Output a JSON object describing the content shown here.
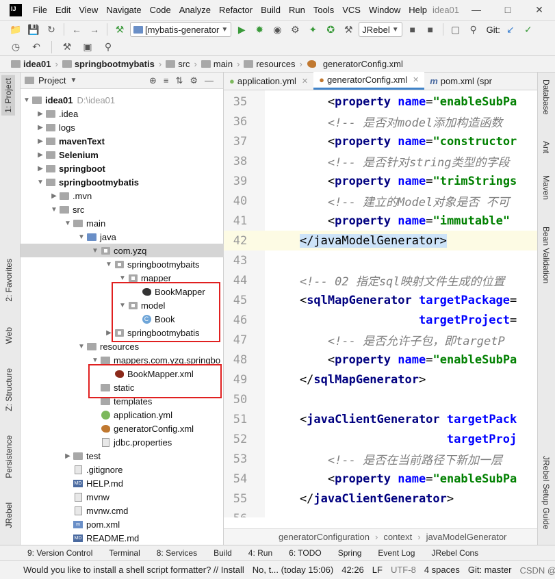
{
  "menubar": {
    "items": [
      "File",
      "Edit",
      "View",
      "Navigate",
      "Code",
      "Analyze",
      "Refactor",
      "Build",
      "Run",
      "Tools",
      "VCS",
      "Window",
      "Help"
    ],
    "window_title": "idea01"
  },
  "toolbar": {
    "run_config": "[mybatis-generator",
    "jrebel": "JRebel",
    "git_label": "Git:"
  },
  "breadcrumb": [
    "idea01",
    "springbootmybatis",
    "src",
    "main",
    "resources",
    "generatorConfig.xml"
  ],
  "project_panel": {
    "title": "Project",
    "tree": [
      {
        "label": "idea01",
        "extra": "D:\\idea01",
        "bold": true
      },
      {
        "label": ".idea"
      },
      {
        "label": "logs"
      },
      {
        "label": "mavenText",
        "bold": true
      },
      {
        "label": "Selenium",
        "bold": true
      },
      {
        "label": "springboot",
        "bold": true
      },
      {
        "label": "springbootmybatis",
        "bold": true
      },
      {
        "label": ".mvn"
      },
      {
        "label": "src"
      },
      {
        "label": "main"
      },
      {
        "label": "java"
      },
      {
        "label": "com.yzq"
      },
      {
        "label": "springbootmybaits"
      },
      {
        "label": "mapper"
      },
      {
        "label": "BookMapper"
      },
      {
        "label": "model"
      },
      {
        "label": "Book"
      },
      {
        "label": "springbootmybatis"
      },
      {
        "label": "resources"
      },
      {
        "label": "mappers.com.yzq.springbo"
      },
      {
        "label": "BookMapper.xml"
      },
      {
        "label": "static"
      },
      {
        "label": "templates"
      },
      {
        "label": "application.yml"
      },
      {
        "label": "generatorConfig.xml"
      },
      {
        "label": "jdbc.properties"
      },
      {
        "label": "test"
      },
      {
        "label": ".gitignore"
      },
      {
        "label": "HELP.md"
      },
      {
        "label": "mvnw"
      },
      {
        "label": "mvnw.cmd"
      },
      {
        "label": "pom.xml"
      },
      {
        "label": "README.md"
      }
    ]
  },
  "left_tabs": [
    "1: Project",
    "2: Favorites",
    "Web",
    "Z: Structure",
    "Persistence",
    "JRebel"
  ],
  "right_tabs": [
    "Database",
    "Ant",
    "Maven",
    "Bean Validation",
    "JRebel Setup Guide"
  ],
  "editor_tabs": [
    "application.yml",
    "generatorConfig.xml",
    "pom.xml (spr"
  ],
  "code_lines": [
    {
      "n": "35",
      "parts": [
        [
          "t",
          "        <"
        ],
        [
          "tag",
          "property"
        ],
        [
          "t",
          " "
        ],
        [
          "attr",
          "name"
        ],
        [
          "t",
          "="
        ],
        [
          "val",
          "\"enableSubPa"
        ]
      ]
    },
    {
      "n": "36",
      "parts": [
        [
          "cmt",
          "        <!-- 是否对model添加构造函数"
        ]
      ]
    },
    {
      "n": "37",
      "parts": [
        [
          "t",
          "        <"
        ],
        [
          "tag",
          "property"
        ],
        [
          "t",
          " "
        ],
        [
          "attr",
          "name"
        ],
        [
          "t",
          "="
        ],
        [
          "val",
          "\"constructor"
        ]
      ]
    },
    {
      "n": "38",
      "parts": [
        [
          "cmt",
          "        <!-- 是否针对string类型的字段"
        ]
      ]
    },
    {
      "n": "39",
      "parts": [
        [
          "t",
          "        <"
        ],
        [
          "tag",
          "property"
        ],
        [
          "t",
          " "
        ],
        [
          "attr",
          "name"
        ],
        [
          "t",
          "="
        ],
        [
          "val",
          "\"trimStrings"
        ]
      ]
    },
    {
      "n": "40",
      "parts": [
        [
          "cmt",
          "        <!-- 建立的Model对象是否 不可"
        ]
      ]
    },
    {
      "n": "41",
      "parts": [
        [
          "t",
          "        <"
        ],
        [
          "tag",
          "property"
        ],
        [
          "t",
          " "
        ],
        [
          "attr",
          "name"
        ],
        [
          "t",
          "="
        ],
        [
          "val",
          "\"immutable\""
        ]
      ]
    },
    {
      "n": "42",
      "parts": [
        [
          "t",
          "    "
        ],
        [
          "hl",
          "</javaModelGenerator>"
        ]
      ]
    },
    {
      "n": "43",
      "parts": []
    },
    {
      "n": "44",
      "parts": [
        [
          "cmt",
          "    <!-- 02 指定sql映射文件生成的位置"
        ]
      ]
    },
    {
      "n": "45",
      "parts": [
        [
          "t",
          "    <"
        ],
        [
          "tag",
          "sqlMapGenerator"
        ],
        [
          "t",
          " "
        ],
        [
          "attr",
          "targetPackage"
        ],
        [
          "t",
          "="
        ]
      ]
    },
    {
      "n": "46",
      "parts": [
        [
          "t",
          "                     "
        ],
        [
          "attr",
          "targetProject"
        ],
        [
          "t",
          "="
        ]
      ]
    },
    {
      "n": "47",
      "parts": [
        [
          "cmt",
          "        <!-- 是否允许子包，即targetP"
        ]
      ]
    },
    {
      "n": "48",
      "parts": [
        [
          "t",
          "        <"
        ],
        [
          "tag",
          "property"
        ],
        [
          "t",
          " "
        ],
        [
          "attr",
          "name"
        ],
        [
          "t",
          "="
        ],
        [
          "val",
          "\"enableSubPa"
        ]
      ]
    },
    {
      "n": "49",
      "parts": [
        [
          "t",
          "    </"
        ],
        [
          "tag",
          "sqlMapGenerator"
        ],
        [
          "t",
          ">"
        ]
      ]
    },
    {
      "n": "50",
      "parts": []
    },
    {
      "n": "51",
      "parts": [
        [
          "t",
          "    <"
        ],
        [
          "tag",
          "javaClientGenerator"
        ],
        [
          "t",
          " "
        ],
        [
          "attr",
          "targetPack"
        ]
      ]
    },
    {
      "n": "52",
      "parts": [
        [
          "t",
          "                         "
        ],
        [
          "attr",
          "targetProj"
        ]
      ]
    },
    {
      "n": "53",
      "parts": [
        [
          "cmt",
          "        <!-- 是否在当前路径下新加一层"
        ]
      ]
    },
    {
      "n": "54",
      "parts": [
        [
          "t",
          "        <"
        ],
        [
          "tag",
          "property"
        ],
        [
          "t",
          " "
        ],
        [
          "attr",
          "name"
        ],
        [
          "t",
          "="
        ],
        [
          "val",
          "\"enableSubPa"
        ]
      ]
    },
    {
      "n": "55",
      "parts": [
        [
          "t",
          "    </"
        ],
        [
          "tag",
          "javaClientGenerator"
        ],
        [
          "t",
          ">"
        ]
      ]
    },
    {
      "n": "56",
      "parts": []
    }
  ],
  "editor_breadcrumb": [
    "generatorConfiguration",
    "context",
    "javaModelGenerator"
  ],
  "bottom_tools": [
    "9: Version Control",
    "Terminal",
    "8: Services",
    "Build",
    "4: Run",
    "6: TODO",
    "Spring",
    "Event Log",
    "JRebel Cons"
  ],
  "status": {
    "message": "Would you like to install a shell script formatter? // Install",
    "msg2": "No, t... (today 15:06)",
    "pos": "42:26",
    "sep": "LF",
    "enc": "UTF-8",
    "indent": "4 spaces",
    "git": "Git: master"
  },
  "watermark": "CSDN @小白菜"
}
